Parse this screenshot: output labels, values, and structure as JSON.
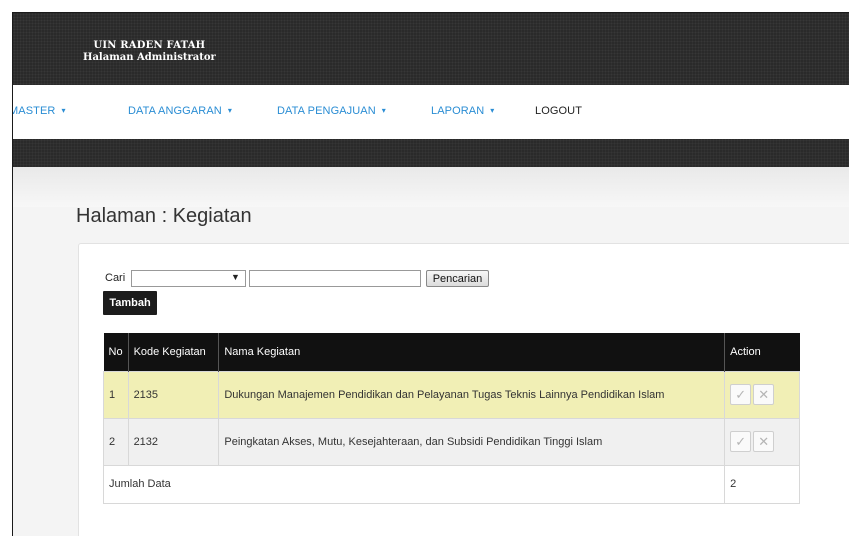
{
  "header": {
    "brand_line1": "UIN RADEN FATAH",
    "brand_line2": "Halaman Administrator"
  },
  "nav": {
    "items": [
      {
        "label": "MASTER",
        "dropdown": true
      },
      {
        "label": "DATA ANGGARAN",
        "dropdown": true
      },
      {
        "label": "DATA PENGAJUAN",
        "dropdown": true
      },
      {
        "label": "LAPORAN",
        "dropdown": true
      },
      {
        "label": "LOGOUT",
        "dropdown": false
      }
    ],
    "chevron": "▾"
  },
  "page": {
    "title": "Halaman : Kegiatan"
  },
  "search": {
    "label": "Cari",
    "select_value": "",
    "select_arrow": "▼",
    "input_value": "",
    "button_label": "Pencarian"
  },
  "add_button_label": "Tambah",
  "table": {
    "headers": [
      "No",
      "Kode Kegiatan",
      "Nama Kegiatan",
      "Action"
    ],
    "rows": [
      {
        "no": "1",
        "kode": "2135",
        "nama": "Dukungan Manajemen Pendidikan dan Pelayanan Tugas Teknis Lainnya Pendidikan Islam"
      },
      {
        "no": "2",
        "kode": "2132",
        "nama": "Peingkatan Akses, Mutu, Kesejahteraan, dan Subsidi Pendidikan Tinggi Islam"
      }
    ],
    "footer_label": "Jumlah Data",
    "footer_count": "2"
  },
  "icons": {
    "check": "✓",
    "close": "✕"
  },
  "colors": {
    "link": "#2a8dd4",
    "header_bg": "#2a2a2a",
    "table_header_bg": "#111111",
    "highlight_row": "#f1efb5"
  }
}
